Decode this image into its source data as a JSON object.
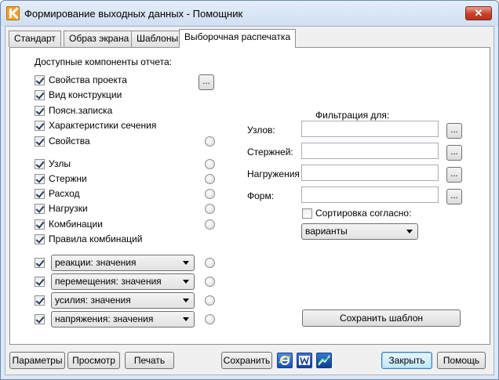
{
  "window": {
    "title": "Формирование выходных данных - Помощник",
    "close_glyph": "✕"
  },
  "tabs": [
    "Стандарт",
    "Образ экрана",
    "Шаблоны",
    "Выборочная распечатка"
  ],
  "components": {
    "heading": "Доступные компоненты отчета:",
    "items": [
      {
        "label": "Свойства проекта",
        "checked": true
      },
      {
        "label": "Вид конструкции",
        "checked": true
      },
      {
        "label": "Поясн.записка",
        "checked": true
      },
      {
        "label": "Характеристики сечения",
        "checked": true
      },
      {
        "label": "Свойства",
        "checked": true
      },
      {
        "label": "Узлы",
        "checked": true
      },
      {
        "label": "Стержни",
        "checked": true
      },
      {
        "label": "Расход",
        "checked": true
      },
      {
        "label": "Нагрузки",
        "checked": true
      },
      {
        "label": "Комбинации",
        "checked": true
      },
      {
        "label": "Правила комбинаций",
        "checked": true
      }
    ],
    "project_props_button": "...",
    "result_selects": [
      {
        "value": "реакции: значения",
        "checked": true
      },
      {
        "value": "перемещения: значения",
        "checked": true
      },
      {
        "value": "усилия: значения",
        "checked": true
      },
      {
        "value": "напряжения: значения",
        "checked": true
      }
    ]
  },
  "filter": {
    "heading": "Фильтрация для:",
    "fields": [
      {
        "label": "Узлов:",
        "value": "",
        "button": "..."
      },
      {
        "label": "Стержней:",
        "value": "",
        "button": "..."
      },
      {
        "label": "Нагружения",
        "value": "",
        "button": "..."
      },
      {
        "label": "Форм:",
        "value": "",
        "button": "..."
      }
    ],
    "sort_label": "Сортировка согласно:",
    "sort_checked": false,
    "sort_value": "варианты",
    "save_template": "Сохранить шаблон"
  },
  "footer": {
    "params": "Параметры",
    "preview": "Просмотр",
    "print": "Печать",
    "save": "Сохранить",
    "close": "Закрыть",
    "help": "Помощь",
    "icons": [
      "internet-explorer-icon",
      "word-icon",
      "plot-icon"
    ]
  }
}
